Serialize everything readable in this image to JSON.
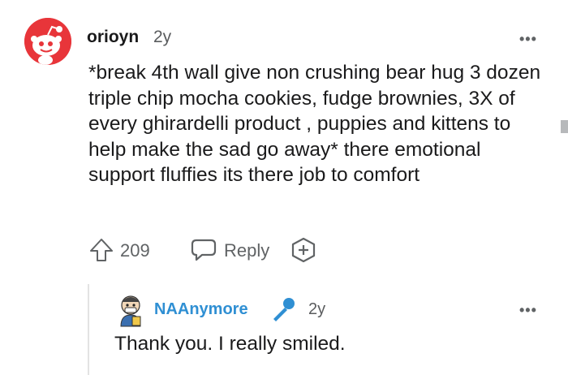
{
  "comment": {
    "username": "orioyn",
    "age": "2y",
    "body": "*break 4th wall give non crushing bear hug 3 dozen triple chip mocha cookies, fudge brownies, 3X of every ghirardelli product , puppies and kittens to help make the sad go away* there emotional support fluffies its there job to comfort",
    "upvotes": "209",
    "reply_label": "Reply",
    "more_label": "•••"
  },
  "reply": {
    "username": "NAAnymore",
    "age": "2y",
    "body": "Thank you. I really smiled.",
    "more_label": "•••"
  },
  "colors": {
    "avatar_red": "#e8353a",
    "username_blue": "#2f8fd3",
    "mic_blue": "#2f8fd3",
    "meta_gray": "#606365"
  },
  "icons": [
    "reddit-snoo-avatar-icon",
    "upvote-icon",
    "reply-icon",
    "add-award-icon",
    "user-avatar-icon",
    "microphone-icon",
    "more-options-icon"
  ]
}
